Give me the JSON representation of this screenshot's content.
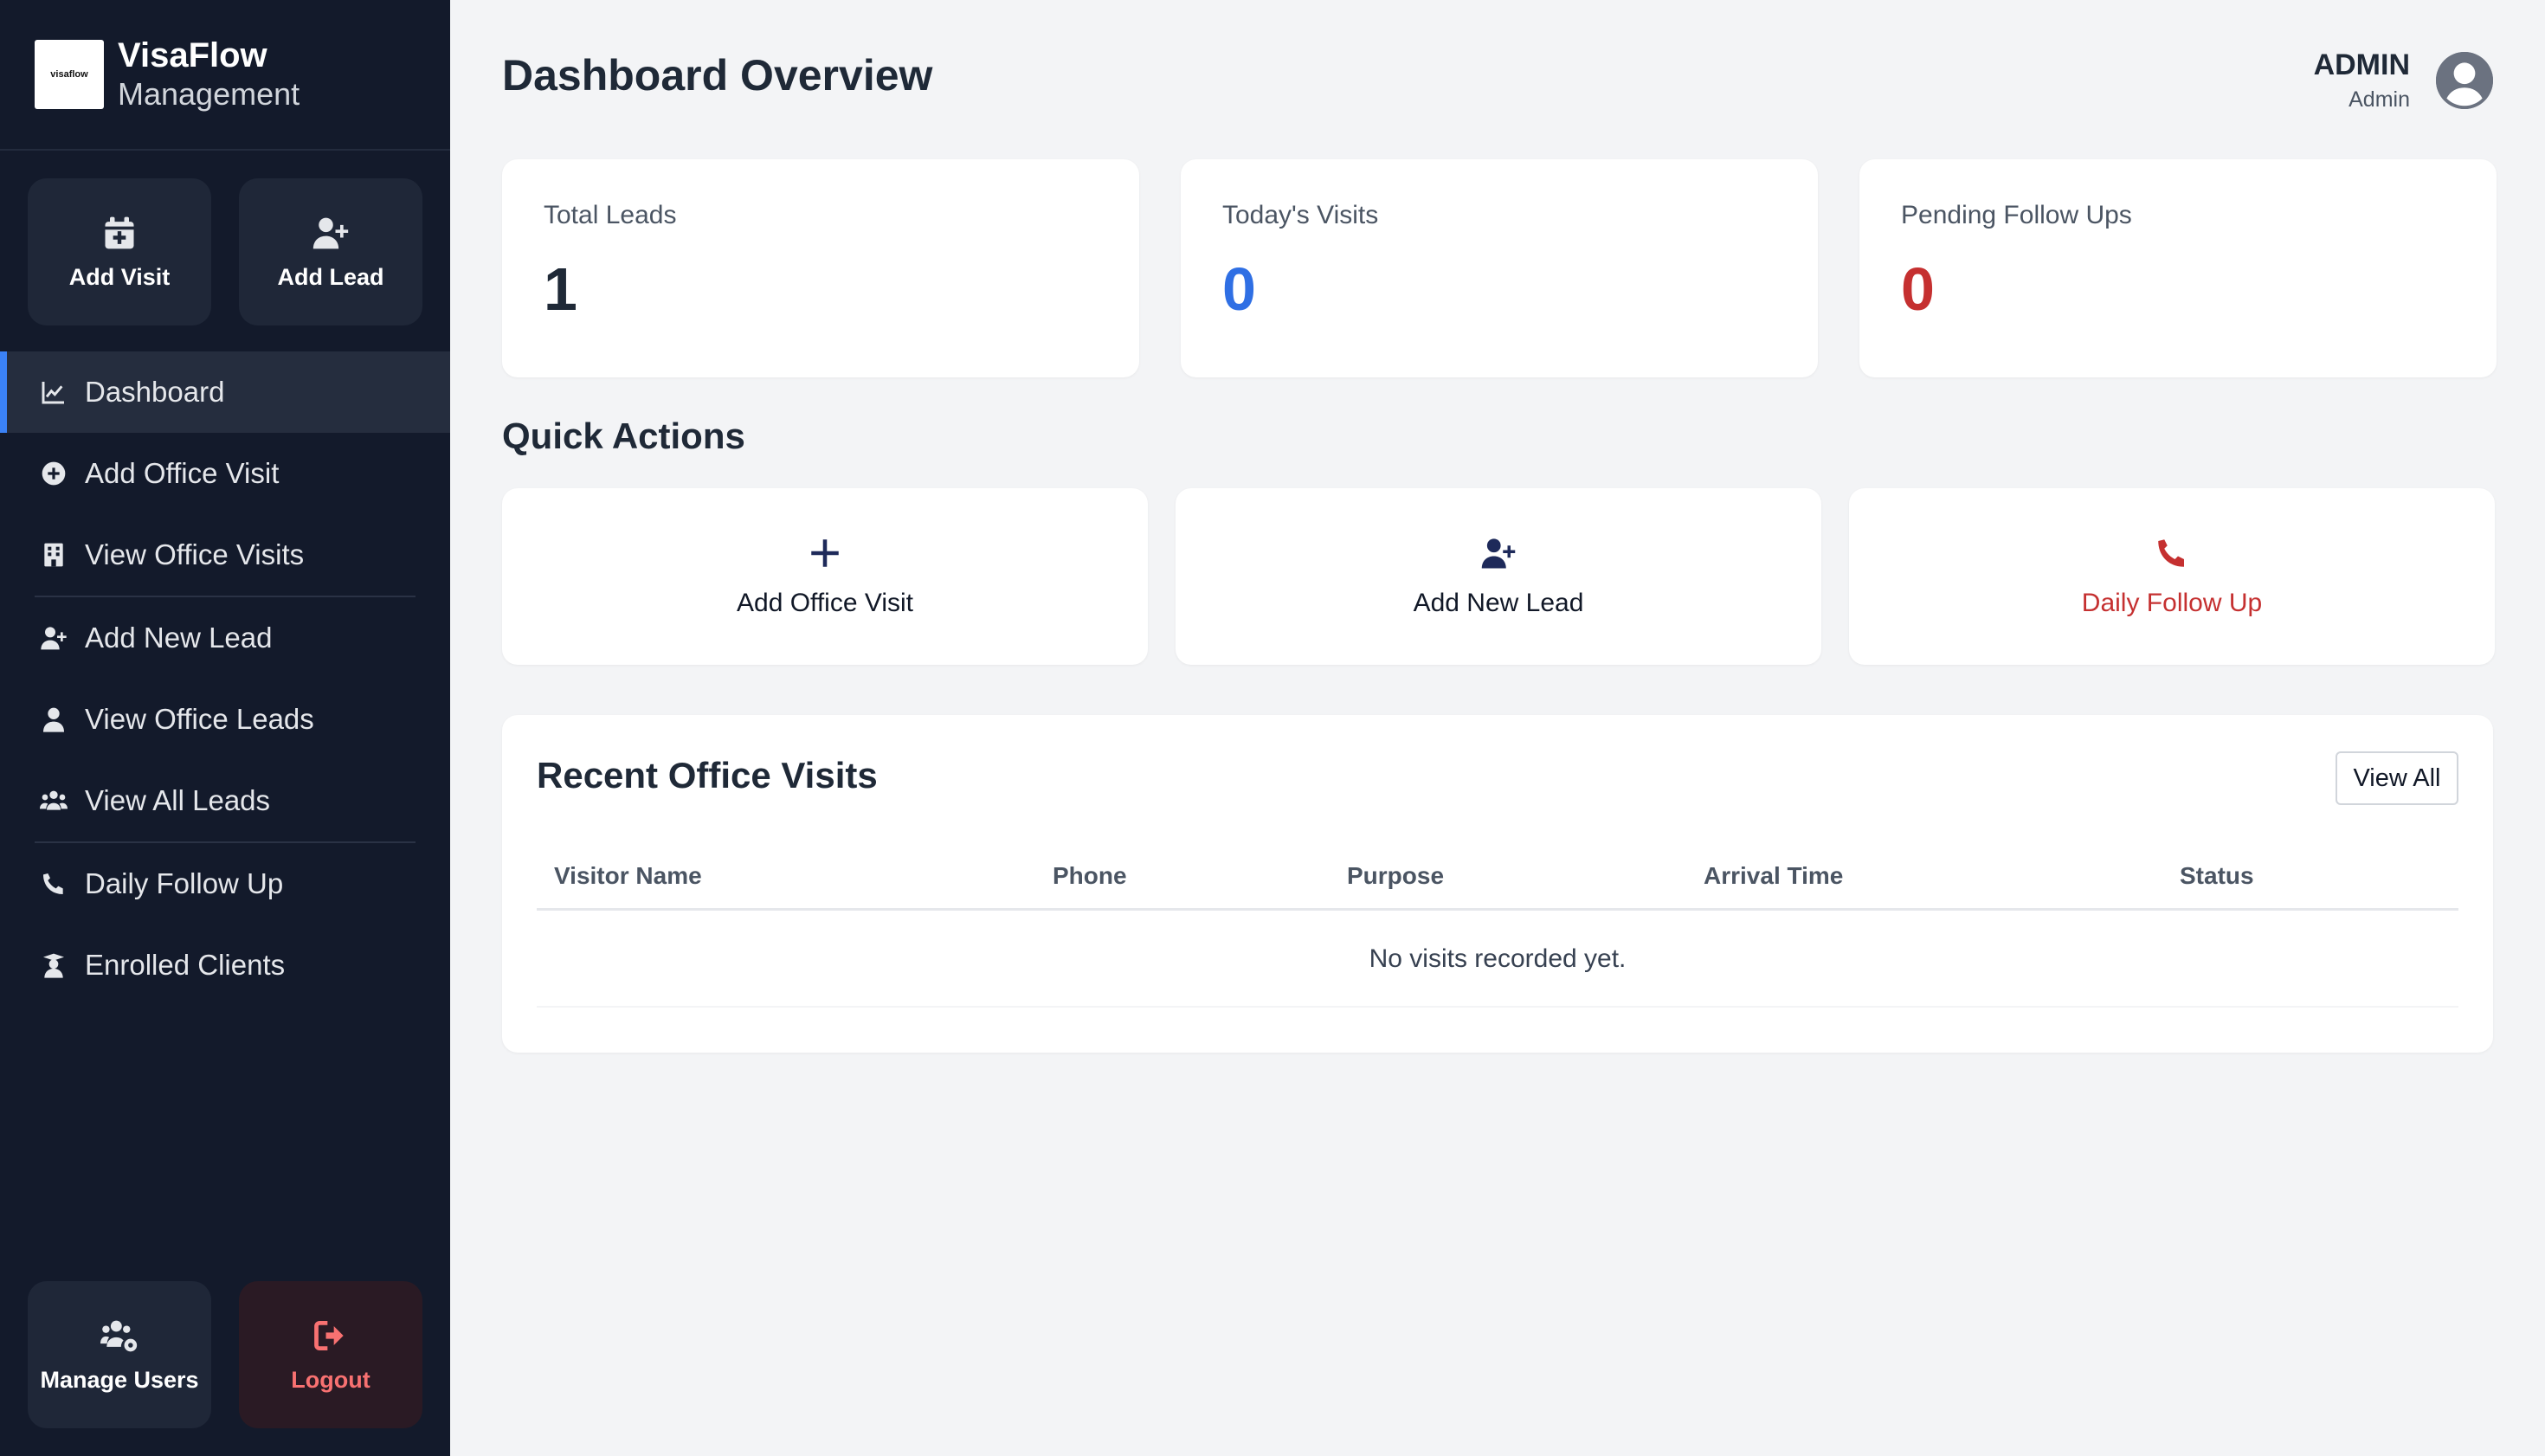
{
  "brand": {
    "logo_text": "visaflow",
    "name": "VisaFlow",
    "subtitle": "Management"
  },
  "sidebar_top_buttons": [
    {
      "label": "Add Visit",
      "icon": "calendar-plus-icon"
    },
    {
      "label": "Add Lead",
      "icon": "user-plus-icon"
    }
  ],
  "nav": [
    {
      "label": "Dashboard",
      "icon": "chart-line-icon",
      "active": true
    },
    {
      "label": "Add Office Visit",
      "icon": "plus-circle-icon"
    },
    {
      "label": "View Office Visits",
      "icon": "building-icon"
    },
    {
      "label": "Add New Lead",
      "icon": "user-plus-icon"
    },
    {
      "label": "View Office Leads",
      "icon": "user-tie-icon"
    },
    {
      "label": "View All Leads",
      "icon": "users-icon"
    },
    {
      "label": "Daily Follow Up",
      "icon": "phone-icon"
    },
    {
      "label": "Enrolled Clients",
      "icon": "graduate-icon"
    }
  ],
  "sidebar_bottom_buttons": [
    {
      "label": "Manage Users",
      "icon": "users-cog-icon"
    },
    {
      "label": "Logout",
      "icon": "sign-out-icon"
    }
  ],
  "header": {
    "title": "Dashboard Overview",
    "user_name": "ADMIN",
    "user_role": "Admin"
  },
  "stats": [
    {
      "label": "Total Leads",
      "value": "1",
      "color": "#1f2937"
    },
    {
      "label": "Today's Visits",
      "value": "0",
      "color": "#2f6fe4"
    },
    {
      "label": "Pending Follow Ups",
      "value": "0",
      "color": "#c53030"
    }
  ],
  "quick_actions": {
    "title": "Quick Actions",
    "items": [
      {
        "label": "Add Office Visit",
        "icon": "plus-icon"
      },
      {
        "label": "Add New Lead",
        "icon": "user-plus-icon"
      },
      {
        "label": "Daily Follow Up",
        "icon": "phone-icon"
      }
    ]
  },
  "recent_visits": {
    "title": "Recent Office Visits",
    "view_all_label": "View All",
    "columns": [
      "Visitor Name",
      "Phone",
      "Purpose",
      "Arrival Time",
      "Status"
    ],
    "empty_message": "No visits recorded yet."
  },
  "colors": {
    "sidebar_bg": "#131a2b",
    "accent_blue": "#3b82f6",
    "danger_red": "#c53030",
    "navy_icon": "#1e2a5a"
  }
}
